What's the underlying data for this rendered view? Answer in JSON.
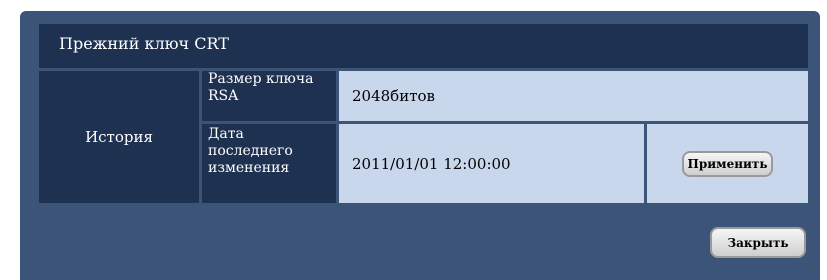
{
  "header": {
    "title": "Прежний ключ CRT"
  },
  "section": {
    "label": "История"
  },
  "rows": [
    {
      "label": "Размер ключа RSA",
      "value": "2048битов"
    },
    {
      "label": "Дата последнего изменения",
      "value": "2011/01/01 12:00:00"
    }
  ],
  "buttons": {
    "apply": "Применить",
    "close": "Закрыть"
  }
}
